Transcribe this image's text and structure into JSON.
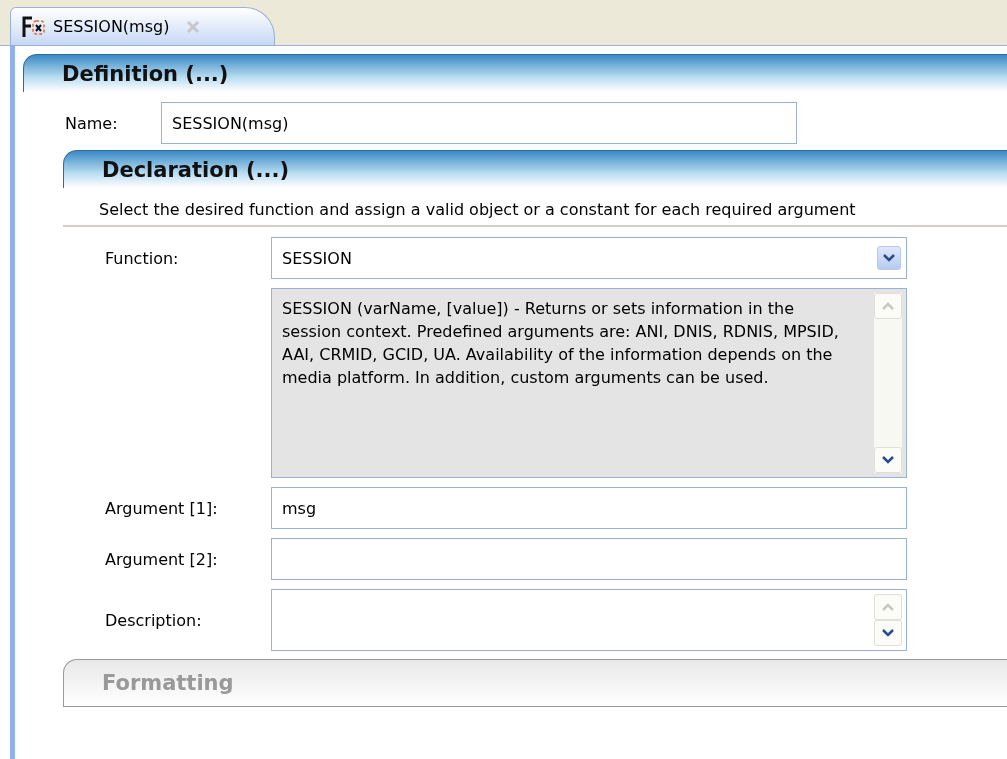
{
  "tab": {
    "title": "SESSION(msg)",
    "selected": true
  },
  "definition": {
    "title": "Definition (...)",
    "expanded": true,
    "name_label": "Name:",
    "name_value": "SESSION(msg)"
  },
  "declaration": {
    "title": "Declaration (...)",
    "expanded": true,
    "hint": "Select the desired function and assign a valid object or a constant for each required argument",
    "function_label": "Function:",
    "function_value": "SESSION",
    "help_text": "SESSION (varName, [value]) - Returns or sets information in the session context. Predefined arguments are: ANI, DNIS, RDNIS, MPSID, AAI, CRMID, GCID, UA. Availability of the information depends on the media platform. In addition, custom arguments can be used.",
    "arguments": [
      {
        "label": "Argument [1]:",
        "value": "msg"
      },
      {
        "label": "Argument [2]:"
      }
    ],
    "description_label": "Description:"
  },
  "formatting": {
    "title": "Formatting",
    "expanded": false
  }
}
